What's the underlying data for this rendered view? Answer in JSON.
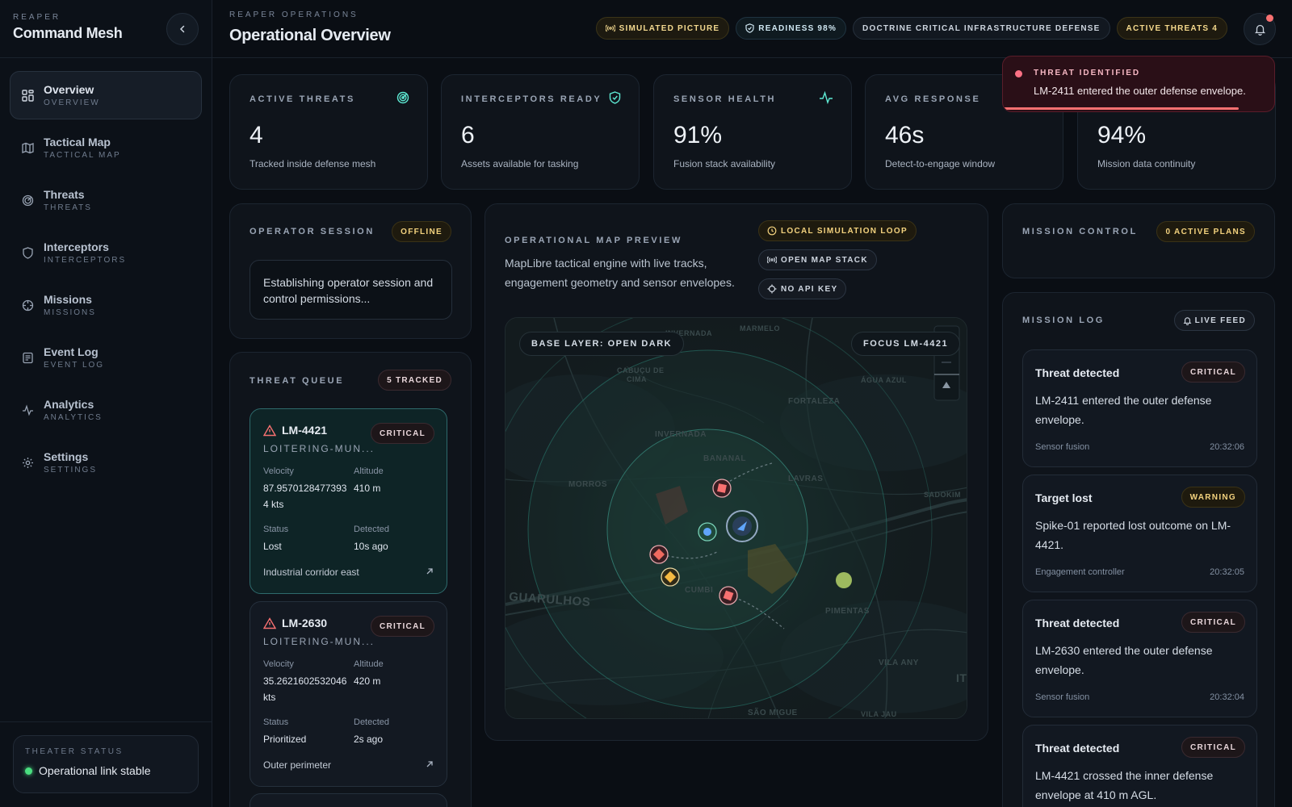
{
  "colors": {
    "accent": "#2dd4bf",
    "critical": "#f87171",
    "warning": "#f5c451",
    "ok": "#4ade80"
  },
  "sidebar": {
    "kicker": "REAPER",
    "title": "Command Mesh",
    "items": [
      {
        "label": "Overview",
        "sub": "OVERVIEW",
        "icon": "grid-icon"
      },
      {
        "label": "Tactical Map",
        "sub": "TACTICAL MAP",
        "icon": "map-icon"
      },
      {
        "label": "Threats",
        "sub": "THREATS",
        "icon": "radar-icon"
      },
      {
        "label": "Interceptors",
        "sub": "INTERCEPTORS",
        "icon": "shield-icon"
      },
      {
        "label": "Missions",
        "sub": "MISSIONS",
        "icon": "crosshair-icon"
      },
      {
        "label": "Event Log",
        "sub": "EVENT LOG",
        "icon": "log-icon"
      },
      {
        "label": "Analytics",
        "sub": "ANALYTICS",
        "icon": "pulse-icon"
      },
      {
        "label": "Settings",
        "sub": "SETTINGS",
        "icon": "gear-icon"
      }
    ],
    "theater": {
      "kicker": "THEATER STATUS",
      "status": "Operational link stable"
    }
  },
  "header": {
    "kicker": "REAPER OPERATIONS",
    "title": "Operational Overview",
    "pills": {
      "simulated": "SIMULATED PICTURE",
      "readiness": "READINESS 98%",
      "doctrine": "DOCTRINE CRITICAL INFRASTRUCTURE DEFENSE",
      "threats": "ACTIVE THREATS 4"
    }
  },
  "stats": [
    {
      "label": "ACTIVE THREATS",
      "value": "4",
      "desc": "Tracked inside defense mesh"
    },
    {
      "label": "INTERCEPTORS READY",
      "value": "6",
      "desc": "Assets available for tasking"
    },
    {
      "label": "SENSOR HEALTH",
      "value": "91%",
      "desc": "Fusion stack availability"
    },
    {
      "label": "AVG RESPONSE",
      "value": "46s",
      "desc": "Detect-to-engage window"
    },
    {
      "label": "",
      "value": "94%",
      "desc": "Mission data continuity"
    }
  ],
  "toast": {
    "kicker": "THREAT IDENTIFIED",
    "message": "LM-2411 entered the outer defense envelope.",
    "progress": 0.87
  },
  "session": {
    "title": "OPERATOR SESSION",
    "badge": "OFFLINE",
    "message": "Establishing operator session and control permissions..."
  },
  "queue": {
    "title": "THREAT QUEUE",
    "badge": "5 TRACKED",
    "labels": {
      "velocity": "Velocity",
      "altitude": "Altitude",
      "status": "Status",
      "detected": "Detected"
    },
    "items": [
      {
        "id": "LM-4421",
        "type": "LOITERING-MUN...",
        "severity": "CRITICAL",
        "velocity": "87.9570128477393 4 kts",
        "altitude": "410 m",
        "status": "Lost",
        "detected": "10s ago",
        "location": "Industrial corridor east"
      },
      {
        "id": "LM-2630",
        "type": "LOITERING-MUN...",
        "severity": "CRITICAL",
        "velocity": "35.2621602532046 kts",
        "altitude": "420 m",
        "status": "Prioritized",
        "detected": "2s ago",
        "location": "Outer perimeter"
      }
    ]
  },
  "map": {
    "title": "OPERATIONAL MAP PREVIEW",
    "description": "MapLibre tactical engine with live tracks, engagement geometry and sensor envelopes.",
    "chips": {
      "sim": "LOCAL SIMULATION LOOP",
      "stack": "OPEN MAP STACK",
      "api": "NO API KEY"
    },
    "base_layer": "BASE LAYER: OPEN DARK",
    "focus": "FOCUS LM-4421",
    "places": {
      "invernada_top": "INVERNADA",
      "marmelo": "MARMELO",
      "cabucu": "CABUÇU DE",
      "cima": "CIMA",
      "agua_azul": "ÁGUA AZUL",
      "fortaleza": "FORTALEZA",
      "invernada": "INVERNADA",
      "bananal": "BANANAL",
      "morros": "MORROS",
      "lavras": "LAVRAS",
      "sadokim": "SADOKIM",
      "guarulhos": "GUARULHOS",
      "cumbica": "CUMBI",
      "pimentas": "PIMENTAS",
      "vila_any": "VILA ANY",
      "it": "IT",
      "sao_miguel": "SÃO MIGUE",
      "vila_jau": "VILA JAU"
    }
  },
  "mission_control": {
    "title": "MISSION CONTROL",
    "badge": "0 ACTIVE PLANS"
  },
  "mission_log": {
    "title": "MISSION LOG",
    "badge": "LIVE FEED",
    "entries": [
      {
        "title": "Threat detected",
        "severity": "CRITICAL",
        "body": "LM-2411 entered the outer defense envelope.",
        "source": "Sensor fusion",
        "time": "20:32:06"
      },
      {
        "title": "Target lost",
        "severity": "WARNING",
        "body": "Spike-01 reported lost outcome on LM-4421.",
        "source": "Engagement controller",
        "time": "20:32:05"
      },
      {
        "title": "Threat detected",
        "severity": "CRITICAL",
        "body": "LM-2630 entered the outer defense envelope.",
        "source": "Sensor fusion",
        "time": "20:32:04"
      },
      {
        "title": "Threat detected",
        "severity": "CRITICAL",
        "body": "LM-4421 crossed the inner defense envelope at 410 m AGL.",
        "source": "",
        "time": ""
      }
    ]
  }
}
